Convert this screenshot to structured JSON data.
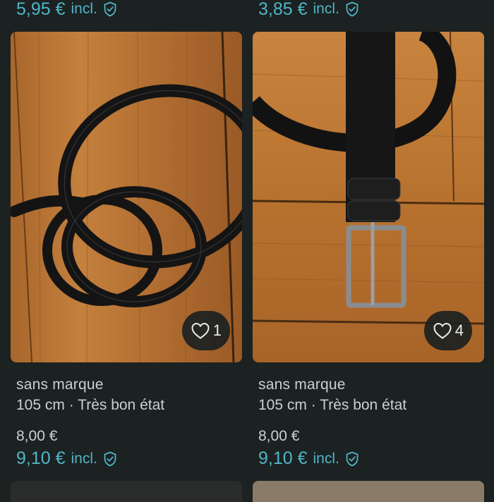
{
  "top_row": [
    {
      "price_incl": "5,95 €",
      "incl_label": "incl."
    },
    {
      "price_incl": "3,85 €",
      "incl_label": "incl."
    }
  ],
  "items": [
    {
      "brand": "sans marque",
      "details": "105 cm · Très bon état",
      "price": "8,00 €",
      "price_incl": "9,10 €",
      "incl_label": "incl.",
      "favorites": "1",
      "icons": {
        "favorite": "heart-outline",
        "buyer_protection": "shield-check"
      }
    },
    {
      "brand": "sans marque",
      "details": "105 cm · Très bon état",
      "price": "8,00 €",
      "price_incl": "9,10 €",
      "incl_label": "incl.",
      "favorites": "4",
      "icons": {
        "favorite": "heart-outline",
        "buyer_protection": "shield-check"
      }
    }
  ],
  "colors": {
    "background": "#1c2121",
    "accent": "#4fb6c8",
    "text": "#c9d1d1"
  }
}
